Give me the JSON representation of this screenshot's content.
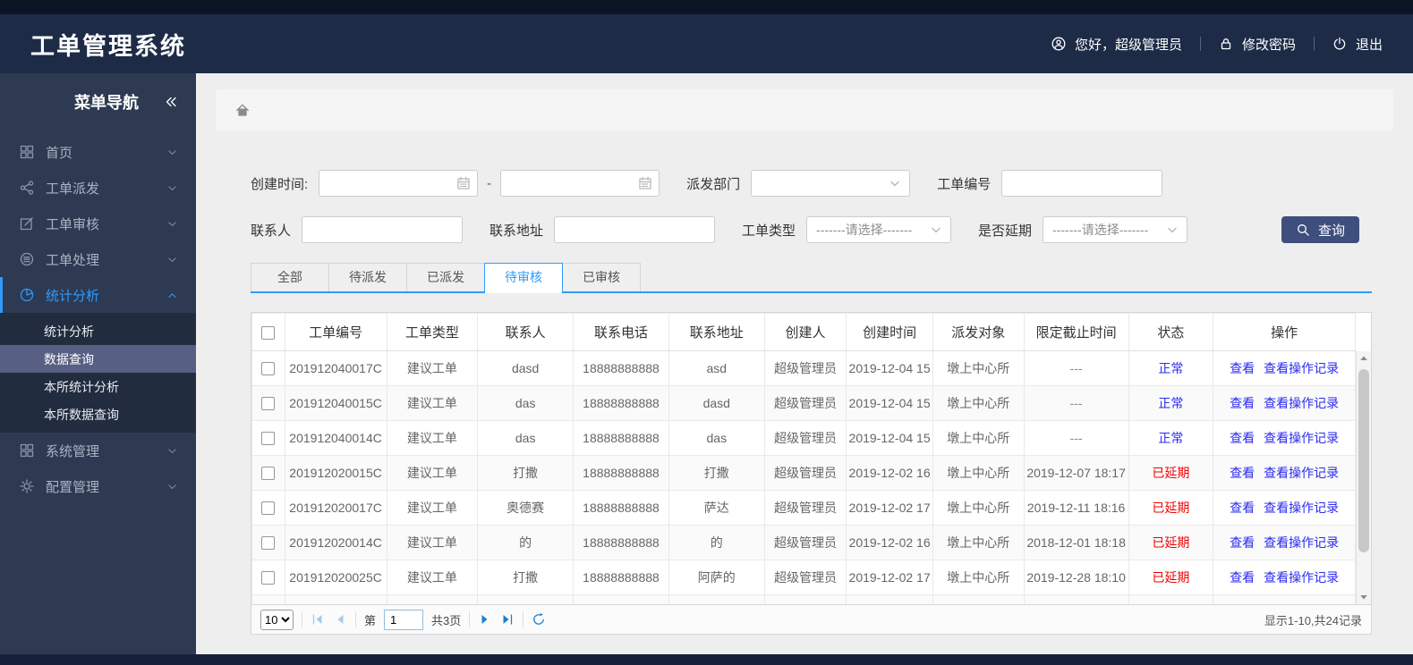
{
  "colors": {
    "accent": "#2e9aff",
    "header_bg": "#1e2b47",
    "sidebar_bg": "#2d3a52",
    "submenu_selected_bg": "#575f84",
    "search_button_bg": "#3e4e7d",
    "status_normal": "#2b2bf1",
    "status_delayed": "#f20000",
    "link": "#2b2bf1"
  },
  "header": {
    "title": "工单管理系统",
    "user_icon": "person-icon",
    "greeting": "您好，超级管理员",
    "password_icon": "lock-icon",
    "change_password": "修改密码",
    "logout_icon": "power-icon",
    "logout": "退出"
  },
  "sidebar": {
    "title": "菜单导航",
    "collapse_icon": "double-chevron-left-icon",
    "items": [
      {
        "label": "首页",
        "icon": "grid",
        "state": "collapsed"
      },
      {
        "label": "工单派发",
        "icon": "share",
        "state": "collapsed"
      },
      {
        "label": "工单审核",
        "icon": "edit",
        "state": "collapsed"
      },
      {
        "label": "工单处理",
        "icon": "process",
        "state": "collapsed"
      },
      {
        "label": "统计分析",
        "icon": "pie",
        "state": "expanded",
        "active": true,
        "children": [
          {
            "label": "统计分析",
            "selected": false
          },
          {
            "label": "数据查询",
            "selected": true
          },
          {
            "label": "本所统计分析",
            "selected": false
          },
          {
            "label": "本所数据查询",
            "selected": false
          }
        ]
      },
      {
        "label": "系统管理",
        "icon": "grid",
        "state": "collapsed"
      },
      {
        "label": "配置管理",
        "icon": "gear",
        "state": "collapsed"
      }
    ]
  },
  "breadcrumb": {
    "home_icon": "home-icon"
  },
  "filters": {
    "created_time_label": "创建时间:",
    "created_from_value": "",
    "created_to_value": "",
    "range_separator": "-",
    "dispatch_dept_label": "派发部门",
    "dispatch_dept_value": "",
    "order_no_label": "工单编号",
    "order_no_value": "",
    "contact_label": "联系人",
    "contact_value": "",
    "address_label": "联系地址",
    "address_value": "",
    "order_type_label": "工单类型",
    "order_type_value": "-------请选择-------",
    "delayed_label": "是否延期",
    "delayed_value": "-------请选择-------",
    "calendar_icon": "calendar-icon",
    "caret_icon": "caret-down-icon",
    "search_icon": "search-icon",
    "search_button": "查询"
  },
  "tabs": {
    "items": [
      "全部",
      "待派发",
      "已派发",
      "待审核",
      "已审核"
    ],
    "active": "待审核"
  },
  "table": {
    "columns": [
      "工单编号",
      "工单类型",
      "联系人",
      "联系电话",
      "联系地址",
      "创建人",
      "创建时间",
      "派发对象",
      "限定截止时间",
      "状态",
      "操作"
    ],
    "op_links": [
      "查看",
      "查看操作记录"
    ],
    "rows": [
      {
        "order_no": "201912040017C",
        "type": "建议工单",
        "contact": "dasd",
        "phone": "18888888888",
        "address": "asd",
        "creator": "超级管理员",
        "created": "2019-12-04 15",
        "dispatch": "墩上中心所",
        "deadline": "---",
        "status": "正常",
        "status_type": "normal"
      },
      {
        "order_no": "201912040015C",
        "type": "建议工单",
        "contact": "das",
        "phone": "18888888888",
        "address": "dasd",
        "creator": "超级管理员",
        "created": "2019-12-04 15",
        "dispatch": "墩上中心所",
        "deadline": "---",
        "status": "正常",
        "status_type": "normal"
      },
      {
        "order_no": "201912040014C",
        "type": "建议工单",
        "contact": "das",
        "phone": "18888888888",
        "address": "das",
        "creator": "超级管理员",
        "created": "2019-12-04 15",
        "dispatch": "墩上中心所",
        "deadline": "---",
        "status": "正常",
        "status_type": "normal"
      },
      {
        "order_no": "201912020015C",
        "type": "建议工单",
        "contact": "打撒",
        "phone": "18888888888",
        "address": "打撒",
        "creator": "超级管理员",
        "created": "2019-12-02 16",
        "dispatch": "墩上中心所",
        "deadline": "2019-12-07 18:17",
        "status": "已延期",
        "status_type": "delayed"
      },
      {
        "order_no": "201912020017C",
        "type": "建议工单",
        "contact": "奥德赛",
        "phone": "18888888888",
        "address": "萨达",
        "creator": "超级管理员",
        "created": "2019-12-02 17",
        "dispatch": "墩上中心所",
        "deadline": "2019-12-11 18:16",
        "status": "已延期",
        "status_type": "delayed"
      },
      {
        "order_no": "201912020014C",
        "type": "建议工单",
        "contact": "的",
        "phone": "18888888888",
        "address": "的",
        "creator": "超级管理员",
        "created": "2019-12-02 16",
        "dispatch": "墩上中心所",
        "deadline": "2018-12-01 18:18",
        "status": "已延期",
        "status_type": "delayed"
      },
      {
        "order_no": "201912020025C",
        "type": "建议工单",
        "contact": "打撒",
        "phone": "18888888888",
        "address": "阿萨的",
        "creator": "超级管理员",
        "created": "2019-12-02 17",
        "dispatch": "墩上中心所",
        "deadline": "2019-12-28 18:10",
        "status": "已延期",
        "status_type": "delayed"
      }
    ],
    "scrollbar": {
      "up_icon": "triangle-up-icon",
      "down_icon": "triangle-down-icon"
    }
  },
  "pagination": {
    "page_size": "10",
    "first_icon": "page-first-icon",
    "prev_icon": "page-prev-icon",
    "page_prefix": "第",
    "page_value": "1",
    "total_pages": "共3页",
    "next_icon": "page-next-icon",
    "last_icon": "page-last-icon",
    "refresh_icon": "refresh-icon",
    "summary": "显示1-10,共24记录"
  }
}
